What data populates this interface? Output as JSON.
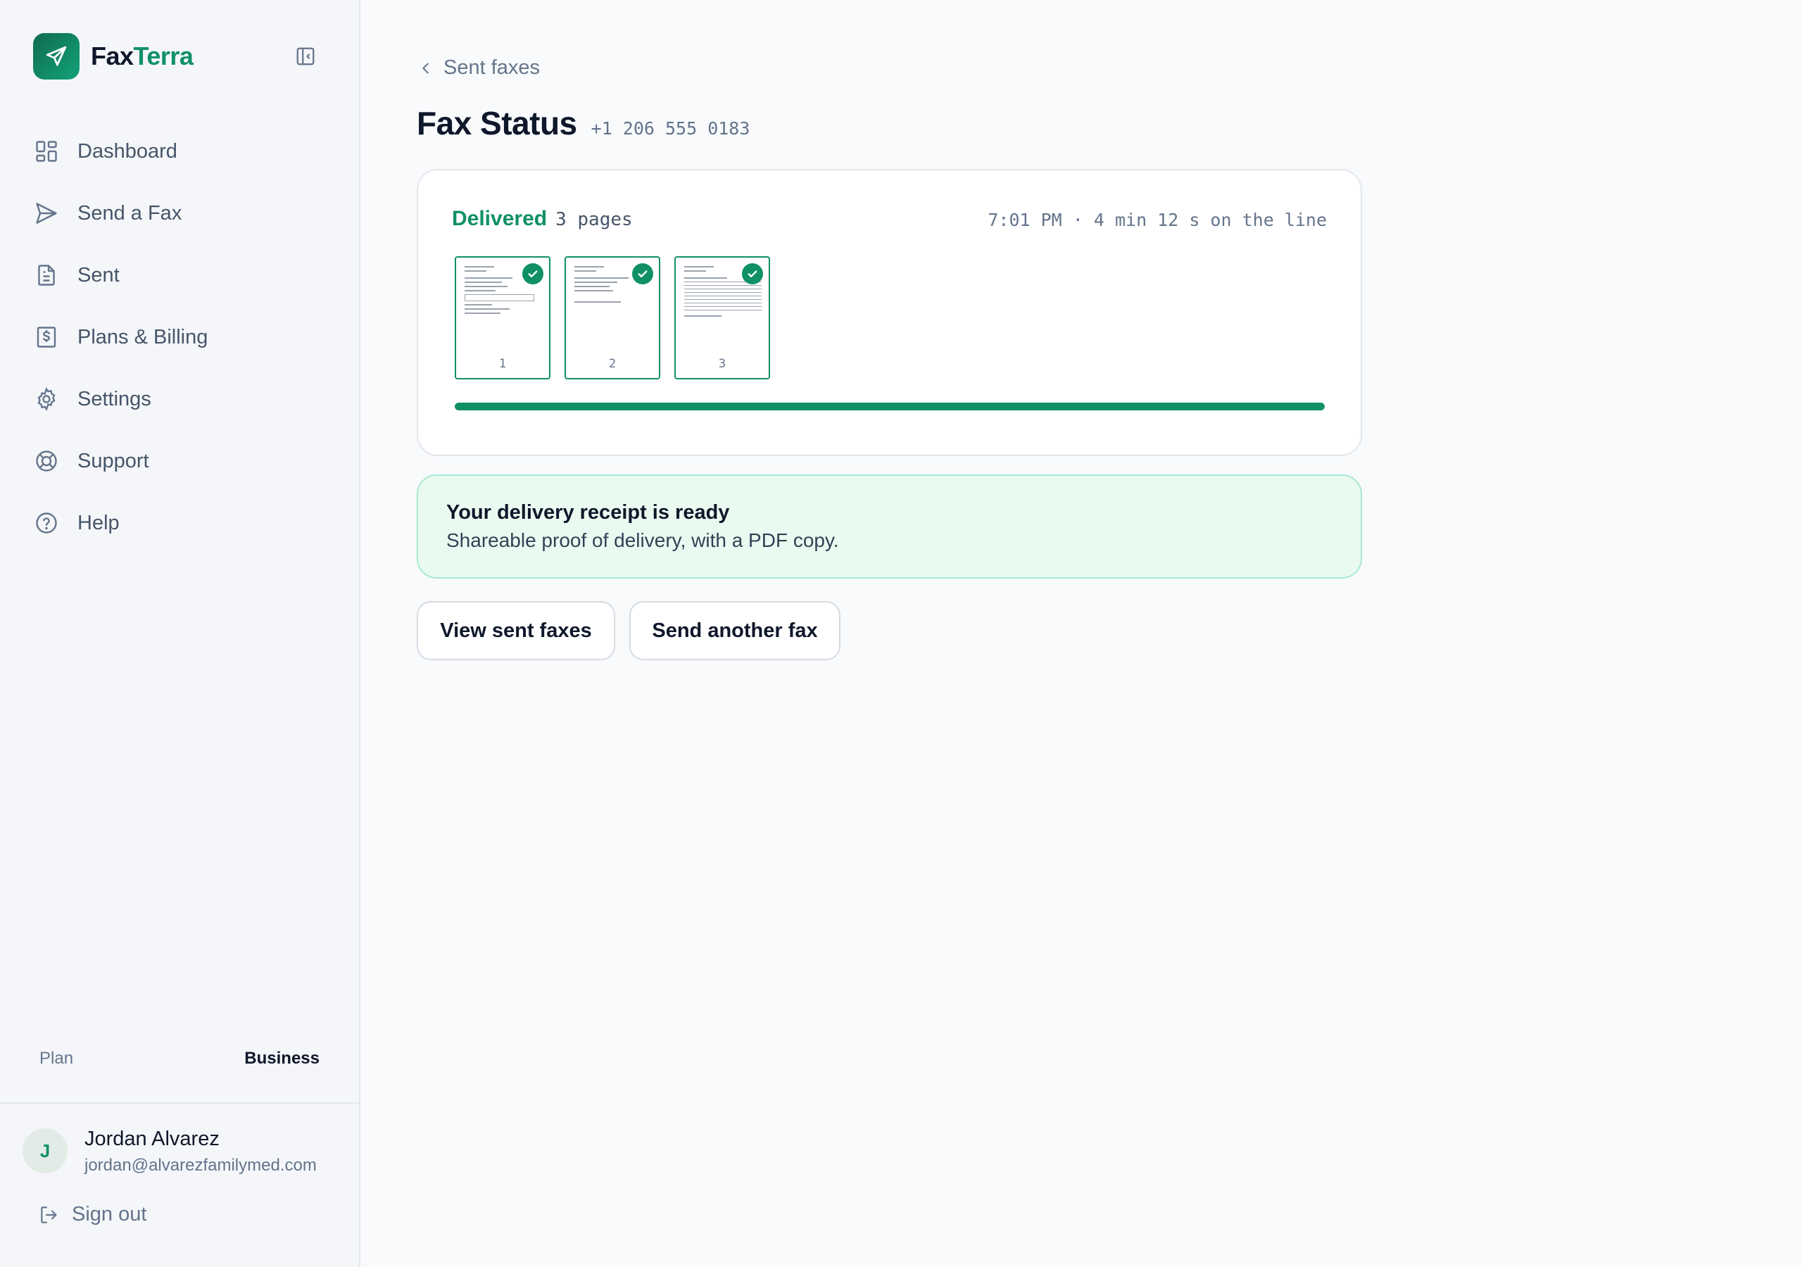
{
  "brand": {
    "name_part1": "Fax",
    "name_part2": "Terra"
  },
  "nav": {
    "items": [
      {
        "label": "Dashboard",
        "icon": "dashboard-icon"
      },
      {
        "label": "Send a Fax",
        "icon": "send-icon"
      },
      {
        "label": "Sent",
        "icon": "document-icon"
      },
      {
        "label": "Plans & Billing",
        "icon": "billing-icon"
      },
      {
        "label": "Settings",
        "icon": "gear-icon"
      },
      {
        "label": "Support",
        "icon": "lifebuoy-icon"
      },
      {
        "label": "Help",
        "icon": "help-icon"
      }
    ]
  },
  "plan": {
    "label": "Plan",
    "value": "Business"
  },
  "user": {
    "initial": "J",
    "name": "Jordan Alvarez",
    "email": "jordan@alvarezfamilymed.com",
    "signout_label": "Sign out"
  },
  "header": {
    "back_label": "Sent faxes",
    "title": "Fax Status",
    "phone": "+1 206 555 0183"
  },
  "status": {
    "state": "Delivered",
    "pages": "3 pages",
    "time_info": "7:01 PM · 4 min 12 s on the line",
    "progress_fraction": 1.0,
    "thumbnails": [
      "1",
      "2",
      "3"
    ]
  },
  "receipt": {
    "title": "Your delivery receipt is ready",
    "subtitle": "Shareable proof of delivery, with a PDF copy."
  },
  "actions": {
    "view_sent": "View sent faxes",
    "send_another": "Send another fax"
  },
  "colors": {
    "accent": "#109067",
    "receipt_bg": "#e9fbf1",
    "receipt_border": "#a8ead0"
  }
}
